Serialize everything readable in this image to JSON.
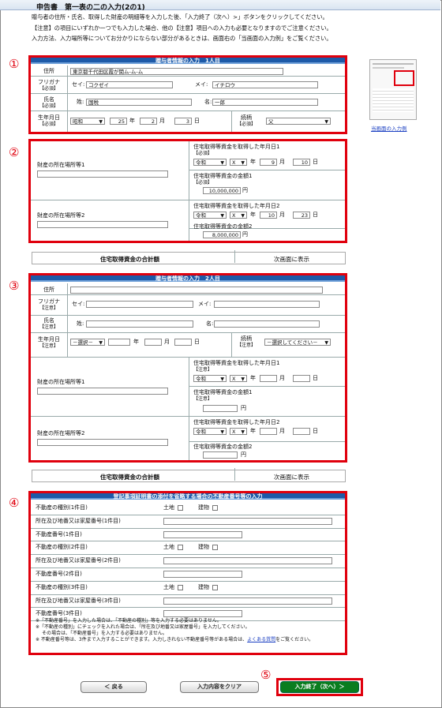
{
  "header": {
    "title": "申告書　第一表の二の入力(2の1)"
  },
  "intro": [
    "贈与者の住所・氏名、取得した財産の明細等を入力した後、「入力終了（次へ）>」ボタンをクリックしてください。",
    "【注意】の項目にいずれか一つでも入力した場合、他の【注意】項目への入力も必要となりますのでご注意ください。",
    "入力方法、入力場所等についてお分かりにならない部分があるときは、画面右の「当画面の入力例」をご覧ください。"
  ],
  "markers": [
    "①",
    "②",
    "③",
    "④",
    "⑤"
  ],
  "thumbnail": {
    "link": "当画面の入力例"
  },
  "labels": {
    "address": "住所",
    "furigana": "フリガナ",
    "name": "氏名",
    "birthdate": "生年月日",
    "relation": "続柄",
    "required": "【必須】",
    "attention": "【注意】",
    "sei": "セイ:",
    "mei": "メイ:",
    "sei_k": "姓:",
    "mei_k": "名:",
    "year": "年",
    "month": "月",
    "day": "日",
    "yen": "円",
    "prop_loc1": "財産の所在場所等1",
    "prop_loc2": "財産の所在場所等2",
    "acq_date1": "住宅取得等資金を取得した年月日1",
    "acq_amt1": "住宅取得等資金の金額1",
    "acq_date2": "住宅取得等資金を取得した年月日2",
    "acq_amt2": "住宅取得等資金の金額2",
    "total": "住宅取得資金の合計額",
    "next_screen": "次画面に表示"
  },
  "donor1": {
    "title": "贈与者情報の入力　1人目",
    "address": "東京都千代田区霞が関ム-ム-ム",
    "sei": "コクゼイ",
    "mei": "イチロウ",
    "sei_k": "国税",
    "mei_k": "一郎",
    "era": "昭和",
    "year": "25",
    "month": "2",
    "day": "3",
    "relation": "父",
    "acq1": {
      "era": "令和",
      "x": "X",
      "year": "",
      "month": "9",
      "day": "10",
      "amount": "10,000,000"
    },
    "acq2": {
      "era": "令和",
      "x": "X",
      "year": "",
      "month": "10",
      "day": "23",
      "amount": "8,000,000"
    }
  },
  "donor2": {
    "title": "贈与者情報の入力　2人目",
    "era": "－選択－",
    "relation": "－選択してください－",
    "acq1": {
      "era": "令和",
      "x": "X"
    },
    "acq2": {
      "era": "令和",
      "x": "X"
    }
  },
  "realestate": {
    "title": "登記事項証明書の添付を省略する場合の不動産番号等の入力",
    "land": "土地",
    "building": "建物",
    "rows": [
      "不動産の種別(1件目)",
      "所在及び地番又は家屋番号(1件目)",
      "不動産番号(1件目)",
      "不動産の種別(2件目)",
      "所在及び地番又は家屋番号(2件目)",
      "不動産番号(2件目)",
      "不動産の種別(3件目)",
      "所在及び地番又は家屋番号(3件目)",
      "不動産番号(3件目)"
    ],
    "notes": [
      "※「不動産番号」を入力した場合は、「不動産の種別」等を入力する必要はありません。",
      "※「不動産の種別」にチェックを入れた場合は、「所在及び地番又は家屋番号」を入力してください。",
      "その場合は、「不動産番号」を入力する必要はありません。",
      "※ 不動産番号等は、3件まで入力することができます。入力しきれない不動産番号等がある場合は、",
      "よくある質問",
      "をご覧ください。"
    ]
  },
  "buttons": {
    "back": "＜ 戻る",
    "clear": "入力内容をクリア",
    "finish": "入力終了（次へ）＞"
  }
}
